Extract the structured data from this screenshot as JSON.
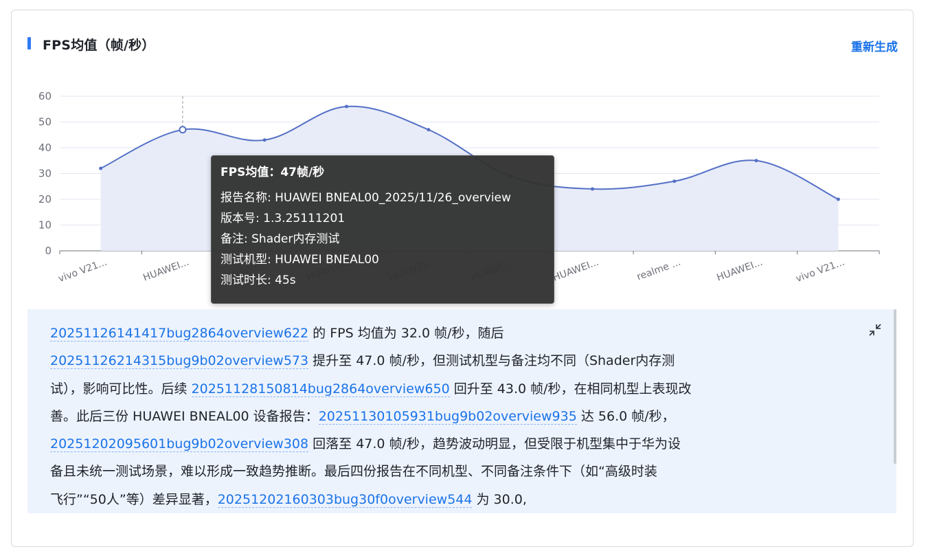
{
  "panel": {
    "title": "FPS均值（帧/秒）",
    "regenerate_label": "重新生成"
  },
  "chart_data": {
    "type": "area",
    "categories": [
      "vivo V21...",
      "HUAWEI...",
      "HUAWEI...",
      "HUAWEI...",
      "HUAWEI...",
      "HUAWEI...",
      "HUAWEI...",
      "realme ...",
      "HUAWEI...",
      "vivo V21..."
    ],
    "series": [
      {
        "values": [
          32,
          47,
          43,
          56,
          47,
          29,
          24,
          27,
          35,
          20
        ]
      }
    ],
    "ylim": [
      0,
      60
    ],
    "yticks": [
      0,
      10,
      20,
      30,
      40,
      50,
      60
    ],
    "grid": true,
    "highlighted_index": 1,
    "colors": {
      "line": "#5470c6",
      "area": "#e8ecf8",
      "grid": "#e0e6f1",
      "axis": "#6e7079"
    }
  },
  "tooltip": {
    "title": "FPS均值：47帧/秒",
    "rows": [
      "报告名称: HUAWEI BNEAL00_2025/11/26_overview",
      "版本号: 1.3.25111201",
      "备注: Shader内存测试",
      "测试机型: HUAWEI BNEAL00",
      "测试时长: 45s"
    ]
  },
  "summary": {
    "segments": [
      {
        "link": "20251126141417bug2864overview622"
      },
      {
        "text": " 的 FPS 均值为 32.0 帧/秒，随后"
      },
      {
        "br": true
      },
      {
        "link": "20251126214315bug9b02overview573"
      },
      {
        "text": " 提升至 47.0 帧/秒，但测试机型与备注均不同（Shader内存测"
      },
      {
        "br": true
      },
      {
        "text": "试），影响可比性。后续 "
      },
      {
        "link": "20251128150814bug2864overview650"
      },
      {
        "text": " 回升至 43.0 帧/秒，在相同机型上表现改"
      },
      {
        "br": true
      },
      {
        "text": "善。此后三份 HUAWEI BNEAL00 设备报告："
      },
      {
        "link": "20251130105931bug9b02overview935"
      },
      {
        "text": " 达 56.0 帧/秒，"
      },
      {
        "br": true
      },
      {
        "link": "20251202095601bug9b02overview308"
      },
      {
        "text": " 回落至 47.0 帧/秒，趋势波动明显，但受限于机型集中于华为设"
      },
      {
        "br": true
      },
      {
        "text": "备且未统一测试场景，难以形成一致趋势推断。最后四份报告在不同机型、不同备注条件下（如“高级时装"
      },
      {
        "br": true
      },
      {
        "text": "飞行”“50人”等）差异显著，"
      },
      {
        "link": "20251202160303bug30f0overview544"
      },
      {
        "text": " 为 30.0,"
      }
    ],
    "collapse_icon": "collapse-icon"
  }
}
